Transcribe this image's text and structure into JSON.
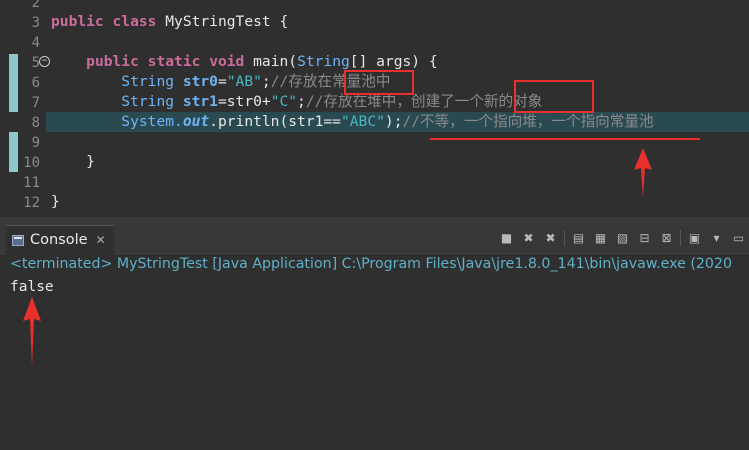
{
  "editor": {
    "line_numbers": [
      "2",
      "3",
      "4",
      "5",
      "6",
      "7",
      "8",
      "9",
      "10",
      "11",
      "12"
    ],
    "lines": {
      "l3": {
        "kw1": "public",
        "kw2": "class",
        "name": "MyStringTest {"
      },
      "l5": {
        "kw1": "public",
        "kw2": "static",
        "kw3": "void",
        "method": "main(",
        "type": "String",
        "rest": "[] args) {"
      },
      "l6": {
        "type": "String",
        "var": "str0",
        "eq": "=",
        "str": "\"AB\"",
        "semi": ";",
        "comment_a": "//存放在",
        "comment_b": "常量池中"
      },
      "l7": {
        "type": "String",
        "var": "str1",
        "expr": "=str0+",
        "str": "\"C\"",
        "semi": ";",
        "comment_a": "//存放在堆中，创建了一个",
        "comment_b": "新的对象"
      },
      "l8": {
        "sys": "System.",
        "field": "out",
        "call": ".println(str1==",
        "str": "\"ABC\"",
        "close": ");",
        "comment": "//不等，一个指向堆，一个指向常量池"
      },
      "l10": {
        "text": "}"
      },
      "l12": {
        "text": "}"
      }
    }
  },
  "console": {
    "tab_label": "Console",
    "tab_close": "✕",
    "terminated_line": "<terminated> MyStringTest [Java Application] C:\\Program Files\\Java\\jre1.8.0_141\\bin\\javaw.exe (2020",
    "output": "false",
    "toolbar_icons": [
      "terminate-icon",
      "remove-launch-icon",
      "remove-all-icon",
      "scroll-lock-icon",
      "show-on-output-icon",
      "show-on-error-icon",
      "pin-console-icon",
      "display-selected-icon",
      "open-console-icon",
      "view-menu-icon"
    ]
  },
  "colors": {
    "annotation": "#e8302c",
    "keyword": "#cc6c9c",
    "string": "#48b7c2",
    "type": "#6fb3f5",
    "comment": "#8a8a8a",
    "terminated": "#5fb0c8"
  }
}
